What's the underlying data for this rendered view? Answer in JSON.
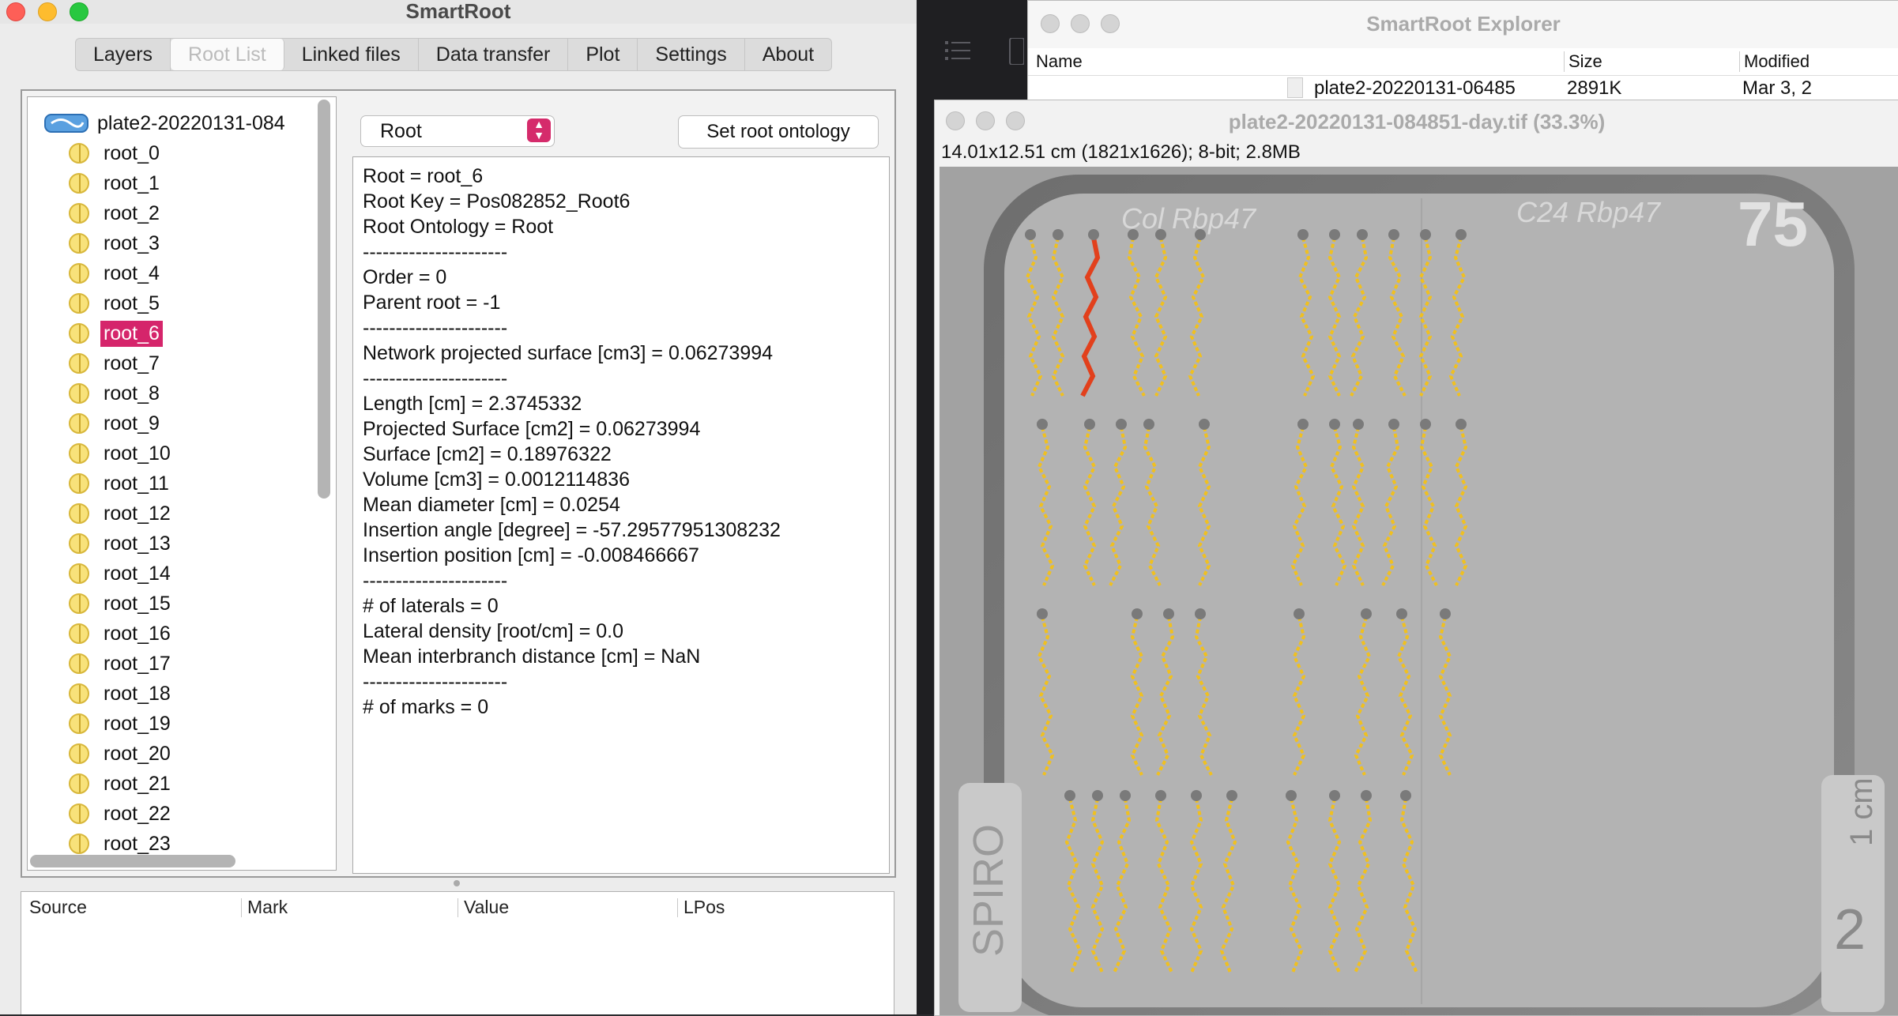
{
  "smartroot": {
    "title": "SmartRoot",
    "tabs": [
      "Layers",
      "Root List",
      "Linked files",
      "Data transfer",
      "Plot",
      "Settings",
      "About"
    ],
    "active_tab": "Root List",
    "tree": {
      "image_node": "plate2-20220131-084",
      "roots": [
        "root_0",
        "root_1",
        "root_2",
        "root_3",
        "root_4",
        "root_5",
        "root_6",
        "root_7",
        "root_8",
        "root_9",
        "root_10",
        "root_11",
        "root_12",
        "root_13",
        "root_14",
        "root_15",
        "root_16",
        "root_17",
        "root_18",
        "root_19",
        "root_20",
        "root_21",
        "root_22",
        "root_23"
      ],
      "selected": "root_6"
    },
    "root_select": {
      "value": "Root"
    },
    "ontology_button": "Set root ontology",
    "info_lines": [
      "Root = root_6",
      "Root Key = Pos082852_Root6",
      "Root Ontology = Root",
      "----------------------",
      "Order = 0",
      "Parent root = -1",
      "----------------------",
      "Network projected surface [cm3] = 0.06273994",
      "----------------------",
      "Length [cm] = 2.3745332",
      "Projected Surface [cm2] = 0.06273994",
      "Surface [cm2] = 0.18976322",
      "Volume [cm3] = 0.0012114836",
      "Mean diameter [cm] = 0.0254",
      "Insertion angle [degree] = -57.29577951308232",
      "Insertion position [cm] = -0.008466667",
      "----------------------",
      "# of laterals = 0",
      "Lateral density [root/cm] = 0.0",
      "Mean interbranch distance [cm] = NaN",
      "----------------------",
      "# of marks = 0"
    ],
    "marks_table": {
      "columns": [
        "Source",
        "Mark",
        "Value",
        "LPos"
      ]
    }
  },
  "explorer": {
    "title": "SmartRoot Explorer",
    "columns": {
      "name": "Name",
      "size": "Size",
      "modified": "Modified"
    },
    "row": {
      "name": "plate2-20220131-06485",
      "size": "2891K",
      "modified": "Mar 3, 2"
    }
  },
  "image_window": {
    "title": "plate2-20220131-084851-day.tif (33.3%)",
    "info": "14.01x12.51 cm (1821x1626); 8-bit; 2.8MB",
    "plate_labels": {
      "left": "Col Rbp47",
      "right": "C24 Rbp47",
      "number": "75",
      "spiro": "SPIRO",
      "scale": "1 cm",
      "scale_num": "2"
    }
  },
  "colors": {
    "selection": "#d5256b",
    "trace": "#f0c020",
    "trace_selected": "#e2401c",
    "node": "#50d040"
  }
}
